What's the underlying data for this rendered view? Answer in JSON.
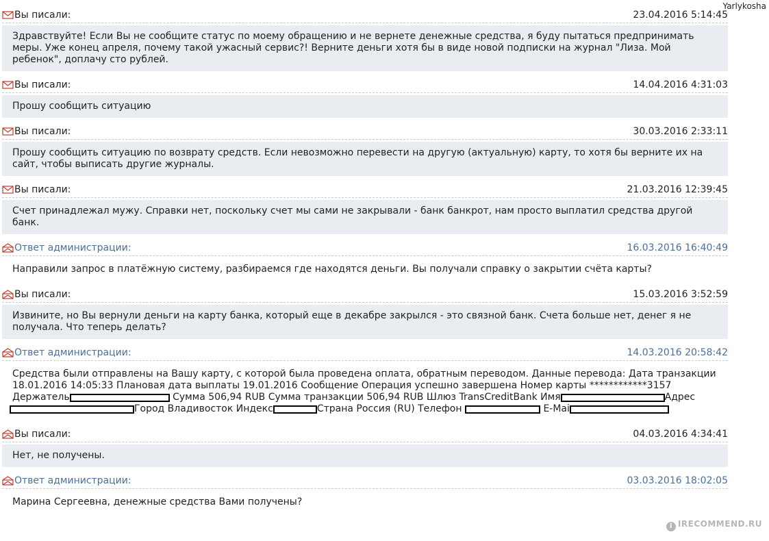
{
  "watermark_top": "Yarlykosha",
  "watermark_bottom": "IRECOMMEND.RU",
  "messages": [
    {
      "author": "Вы писали:",
      "date": "23.04.2016 5:14:45",
      "kind": "user",
      "text": "Здравствуйте! Если Вы не сообщите статус по моему обращению и не вернете денежные средства, я буду пытаться предпринимать меры. Уже конец апреля, почему такой ужасный сервис?! Верните деньги хотя бы в виде новой подписки на журнал \"Лиза. Мой ребенок\", доплачу сто рублей."
    },
    {
      "author": "Вы писали:",
      "date": "14.04.2016 4:31:03",
      "kind": "user",
      "text": "Прошу сообщить ситуацию"
    },
    {
      "author": "Вы писали:",
      "date": "30.03.2016 2:33:11",
      "kind": "user",
      "text": "Прошу сообщить ситуацию по возврату средств. Если невозможно перевести на другую (актуальную) карту, то хотя бы верните их на сайт, чтобы выписать другие журналы."
    },
    {
      "author": "Вы писали:",
      "date": "21.03.2016 12:39:45",
      "kind": "user",
      "text": "Счет принадлежал мужу. Справки нет, поскольку счет мы сами не закрывали - банк банкрот, нам просто выплатил средства другой банк."
    },
    {
      "author": "Ответ администрации:",
      "date": "16.03.2016 16:40:49",
      "kind": "admin",
      "text": "Направили запрос в платёжную систему, разбираемся где находятся деньги. Вы получали справку о закрытии счёта карты?"
    },
    {
      "author": "Вы писали:",
      "date": "15.03.2016 3:52:59",
      "kind": "user-read",
      "text": "Извините, но Вы вернули деньги на карту банка, который еще в декабре закрылся - это связной банк. Счета больше нет, денег я не получала. Что теперь делать?"
    },
    {
      "author": "Ответ администрации:",
      "date": "14.03.2016 20:58:42",
      "kind": "admin",
      "transfer": {
        "line1": "Средства были отправлены на Вашу карту, с которой была проведена оплата, обратным переводом. Данные перевода: Дата транзакции 18.01.2016 14:05:33 Плановая дата выплаты 19.01.2016 Сообщение Операция успешно завершена Номер карты ************3157",
        "holder_label": "Держатель",
        "sum": "Сумма 506,94 RUB Сумма транзакции 506,94 RUB Шлюз TransCreditBank Имя",
        "address_label": "Адрес",
        "city": "Город Владивосток Индекс",
        "country": "Страна Россия (RU) Телефон",
        "email_label": "E-Mai"
      }
    },
    {
      "author": "Вы писали:",
      "date": "04.03.2016 4:34:41",
      "kind": "user-read",
      "text": "Нет, не получены."
    },
    {
      "author": "Ответ администрации:",
      "date": "03.03.2016 18:02:05",
      "kind": "admin",
      "text": "Марина Сергеевна, денежные средства Вами получены?"
    }
  ]
}
